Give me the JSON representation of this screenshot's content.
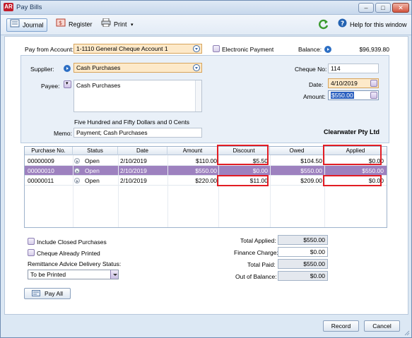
{
  "window": {
    "app_badge": "AR",
    "title": "Pay Bills",
    "minimize": "–",
    "maximize": "□",
    "close": "✕"
  },
  "toolbar": {
    "journal": "Journal",
    "register": "Register",
    "print": "Print",
    "help": "Help for this window"
  },
  "header": {
    "pay_from_label": "Pay from Account:",
    "pay_from_value": "1-1110 General Cheque Account 1",
    "electronic_payment_label": "Electronic Payment",
    "balance_label": "Balance:",
    "balance_value": "$96,939.80"
  },
  "panel": {
    "supplier_label": "Supplier:",
    "supplier_value": "Cash Purchases",
    "payee_label": "Payee:",
    "payee_value": "Cash Purchases",
    "cheque_no_label": "Cheque No:",
    "cheque_no_value": "114",
    "date_label": "Date:",
    "date_value": "4/10/2019",
    "amount_label": "Amount:",
    "amount_value": "$550.00",
    "amount_words": "Five Hundred and Fifty Dollars and 0 Cents",
    "memo_label": "Memo:",
    "memo_value": "Payment; Cash Purchases",
    "company_name": "Clearwater Pty Ltd"
  },
  "grid": {
    "columns": [
      "Purchase No.",
      "Status",
      "Date",
      "Amount",
      "Discount",
      "Owed",
      "Applied"
    ],
    "rows": [
      {
        "purchase_no": "00000009",
        "status": "Open",
        "date": "2/10/2019",
        "amount": "$110.00",
        "discount": "$5.50",
        "owed": "$104.50",
        "applied": "$0.00"
      },
      {
        "purchase_no": "00000010",
        "status": "Open",
        "date": "2/10/2019",
        "amount": "$550.00",
        "discount": "$0.00",
        "owed": "$550.00",
        "applied": "$550.00"
      },
      {
        "purchase_no": "00000011",
        "status": "Open",
        "date": "2/10/2019",
        "amount": "$220.00",
        "discount": "$11.00",
        "owed": "$209.00",
        "applied": "$0.00"
      }
    ]
  },
  "footer": {
    "include_closed_label": "Include Closed Purchases",
    "cheque_printed_label": "Cheque Already Printed",
    "remittance_label": "Remittance Advice Delivery Status:",
    "remittance_value": "To be Printed",
    "pay_all_label": "Pay All",
    "total_applied_label": "Total Applied:",
    "total_applied_value": "$550.00",
    "finance_charge_label": "Finance Charge:",
    "finance_charge_value": "$0.00",
    "total_paid_label": "Total Paid:",
    "total_paid_value": "$550.00",
    "out_of_balance_label": "Out of Balance:",
    "out_of_balance_value": "$0.00",
    "record_label": "Record",
    "cancel_label": "Cancel"
  },
  "colors": {
    "selected_row": "#9d81bf",
    "highlight_box": "#e21d24",
    "orange_field": "#fde9c9"
  }
}
